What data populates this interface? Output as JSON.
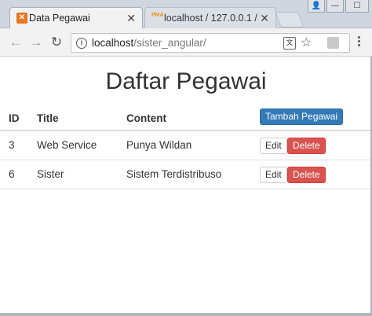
{
  "browser": {
    "tabs": [
      {
        "title": "Data Pegawai",
        "active": true,
        "favicon": "xampp-icon"
      },
      {
        "title": "localhost / 127.0.0.1 /",
        "active": false,
        "favicon": "phpmyadmin-icon"
      }
    ],
    "close_glyph": "✕",
    "favicon_x": "✕",
    "favicon_pma": "PMA",
    "url_host": "localhost",
    "url_path": "/sister_angular/",
    "window_controls": {
      "user": "👤",
      "minimize": "—",
      "maximize": "☐"
    },
    "icons": {
      "back": "←",
      "forward": "→",
      "reload": "↻",
      "info": "i",
      "translate": "文",
      "star": "☆"
    }
  },
  "page": {
    "title": "Daftar Pegawai",
    "table": {
      "headers": {
        "id": "ID",
        "title": "Title",
        "content": "Content"
      },
      "add_button": "Tambah Pegawai",
      "rows": [
        {
          "id": "3",
          "title": "Web Service",
          "content": "Punya Wildan"
        },
        {
          "id": "6",
          "title": "Sister",
          "content": "Sistem Terdistribuso"
        }
      ],
      "edit_label": "Edit",
      "delete_label": "Delete"
    }
  },
  "colors": {
    "primary": "#337ab7",
    "danger": "#d9534f"
  }
}
